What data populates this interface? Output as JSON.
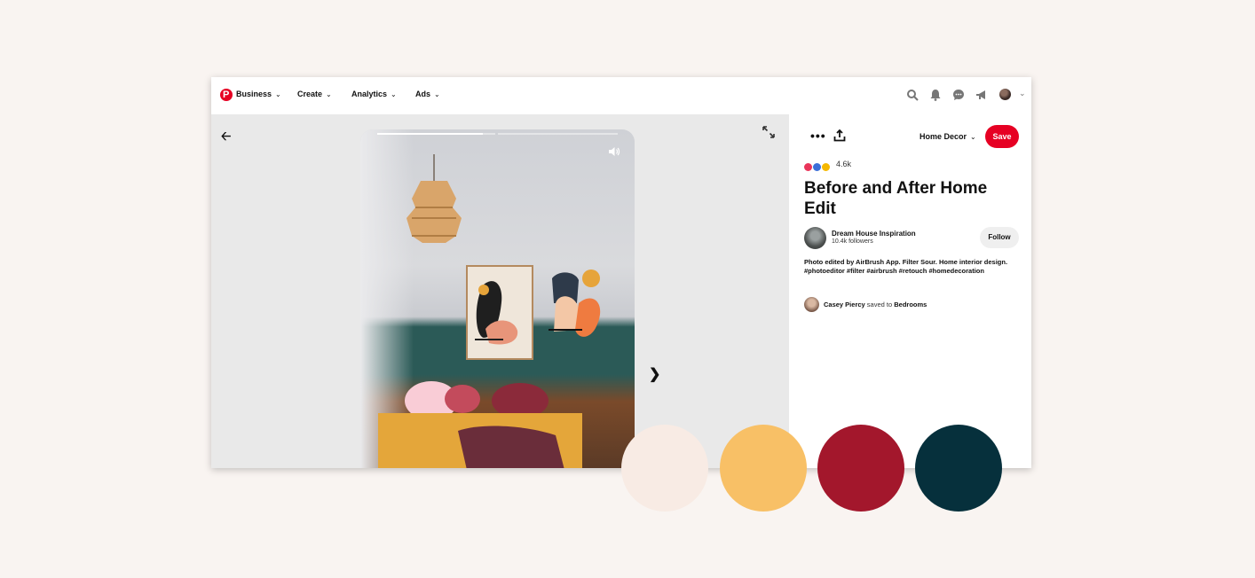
{
  "topnav": {
    "items": [
      {
        "label": "Business"
      },
      {
        "label": "Create"
      },
      {
        "label": "Analytics"
      },
      {
        "label": "Ads"
      }
    ],
    "icons": [
      "search-icon",
      "bell-icon",
      "chat-icon",
      "megaphone-icon",
      "avatar",
      "chevron-down-icon"
    ]
  },
  "pin": {
    "board_select": "Home Decor",
    "save_label": "Save",
    "reaction_count": "4.6k",
    "title": "Before and After Home Edit",
    "author_name": "Dream House Inspiration",
    "followers": "10.4k followers",
    "follow_label": "Follow",
    "description": "Photo edited by AirBrush App. Filter Sour. Home interior design. #photoeditor #filter #airbrush #retouch #homedecoration",
    "saver_name": "Casey Piercy",
    "saved_to_text": "saved to",
    "saver_board": "Bedrooms",
    "video_progress": 0.44
  },
  "palette": [
    "#f8ebe4",
    "#f8c066",
    "#a3172c",
    "#06303c"
  ]
}
